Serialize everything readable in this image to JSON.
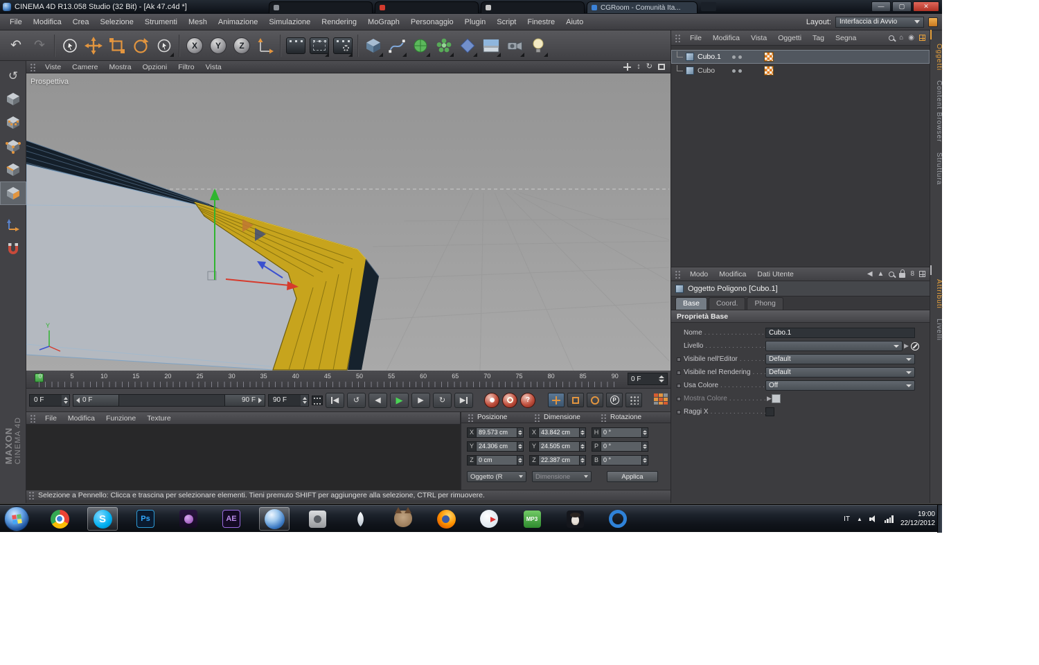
{
  "window": {
    "title": "CINEMA 4D R13.058 Studio (32 Bit) - [Ak 47.c4d *]",
    "active_tab": "CGRoom - Comunità Ita...",
    "min_label": "—",
    "max_label": "▢",
    "close_label": "✕",
    "layout_label": "Layout:",
    "layout_value": "Interfaccia di Avvio"
  },
  "menubar": {
    "items": [
      "File",
      "Modifica",
      "Crea",
      "Selezione",
      "Strumenti",
      "Mesh",
      "Animazione",
      "Simulazione",
      "Rendering",
      "MoGraph",
      "Personaggio",
      "Plugin",
      "Script",
      "Finestre",
      "Aiuto"
    ]
  },
  "toolbar": {
    "axis_x": "X",
    "axis_y": "Y",
    "axis_z": "Z"
  },
  "viewport": {
    "menu": [
      "Viste",
      "Camere",
      "Mostra",
      "Opzioni",
      "Filtro",
      "Vista"
    ],
    "label": "Prospettiva",
    "axis_label": "Y"
  },
  "timeline": {
    "ticks": [
      "0",
      "5",
      "10",
      "15",
      "20",
      "25",
      "30",
      "35",
      "40",
      "45",
      "50",
      "55",
      "60",
      "65",
      "70",
      "75",
      "80",
      "85",
      "90"
    ],
    "frame_box": "0 F"
  },
  "transport": {
    "current": "0 F",
    "range_start": "0 F",
    "range_end": "90 F",
    "end": "90 F"
  },
  "materials": {
    "menu": [
      "File",
      "Modifica",
      "Funzione",
      "Texture"
    ]
  },
  "coords": {
    "headers": [
      "Posizione",
      "Dimensione",
      "Rotazione"
    ],
    "rows": [
      {
        "a": "X",
        "av": "89.573 cm",
        "b": "X",
        "bv": "43.842 cm",
        "c": "H",
        "cv": "0 °"
      },
      {
        "a": "Y",
        "av": "24.306 cm",
        "b": "Y",
        "bv": "24.505 cm",
        "c": "P",
        "cv": "0 °"
      },
      {
        "a": "Z",
        "av": "0 cm",
        "b": "Z",
        "bv": "22.387 cm",
        "c": "B",
        "cv": "0 °"
      }
    ],
    "object_mode": "Oggetto (R",
    "dimension_mode": "Dimensione",
    "apply": "Applica"
  },
  "statusbar": {
    "text": "Selezione a Pennello: Clicca e trascina per selezionare elementi. Tieni premuto SHIFT per aggiungere alla selezione, CTRL per rimuovere."
  },
  "object_manager": {
    "menu": [
      "File",
      "Modifica",
      "Vista",
      "Oggetti",
      "Tag",
      "Segna"
    ],
    "objects": [
      {
        "name": "Cubo.1"
      },
      {
        "name": "Cubo"
      }
    ]
  },
  "attributes": {
    "menu": [
      "Modo",
      "Modifica",
      "Dati Utente"
    ],
    "icon_eight": "8",
    "title": "Oggetto Poligono [Cubo.1]",
    "tabs": [
      "Base",
      "Coord.",
      "Phong"
    ],
    "section": "Proprietà Base",
    "fields": [
      {
        "label": "Nome",
        "value": "Cubo.1"
      },
      {
        "label": "Livello",
        "value": ""
      },
      {
        "label": "Visibile nell'Editor",
        "value": "Default"
      },
      {
        "label": "Visibile nel Rendering",
        "value": "Default"
      },
      {
        "label": "Usa Colore",
        "value": "Off"
      },
      {
        "label": "Mostra Colore",
        "value": ""
      },
      {
        "label": "Raggi X",
        "value": ""
      }
    ]
  },
  "side_tabs": {
    "top": [
      "Oggetti",
      "Content Browser",
      "Struttura"
    ],
    "bottom": [
      "Attributi",
      "Livelli"
    ]
  },
  "branding": {
    "line1": "MAXON",
    "line2": "CINEMA 4D"
  },
  "taskbar": {
    "skype_letter": "S",
    "ps_label": "Ps",
    "ae_label": "AE",
    "mp3_label": "MP3",
    "lang": "IT",
    "time": "19:00",
    "date": "22/12/2012"
  },
  "colors": {
    "accent_orange": "#e2953f",
    "selected_polygon_yellow": "#c7a41d",
    "play_green": "#4ad455",
    "active_tab_orange": "#e8a23c",
    "close_button_red": "#b03225"
  }
}
